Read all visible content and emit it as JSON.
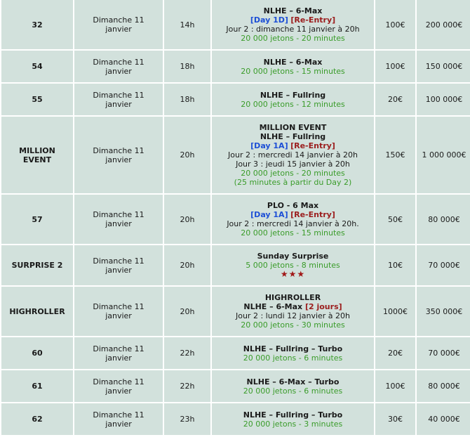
{
  "rows": [
    {
      "num": "32",
      "date": "Dimanche 11\njanvier",
      "time": "14h",
      "lines": [
        {
          "t": "NLHE – 6-Max",
          "c": "name"
        },
        {
          "parts": [
            {
              "t": "[Day 1D]",
              "c": "day"
            },
            {
              "t": " "
            },
            {
              "t": "[Re-Entry]",
              "c": "reentry"
            }
          ]
        },
        {
          "t": "Jour 2 : dimanche 11 janvier à 20h"
        },
        {
          "t": "20 000 jetons - 20 minutes",
          "c": "green"
        }
      ],
      "buyin": "100€",
      "prize": "200 000€",
      "h": 70
    },
    {
      "num": "54",
      "date": "Dimanche 11\njanvier",
      "time": "18h",
      "lines": [
        {
          "t": "NLHE – 6-Max",
          "c": "name"
        },
        {
          "t": "20 000 jetons - 15 minutes",
          "c": "green"
        }
      ],
      "buyin": "100€",
      "prize": "150 000€",
      "h": 45
    },
    {
      "num": "55",
      "date": "Dimanche 11\njanvier",
      "time": "18h",
      "lines": [
        {
          "t": "NLHE – Fullring",
          "c": "name"
        },
        {
          "t": "20 000 jetons - 12 minutes",
          "c": "green"
        }
      ],
      "buyin": "20€",
      "prize": "100 000€",
      "h": 45
    },
    {
      "num": "MILLION\nEVENT",
      "date": "Dimanche 11\njanvier",
      "time": "20h",
      "lines": [
        {
          "t": "MILLION EVENT",
          "c": "name"
        },
        {
          "t": "NLHE – Fullring",
          "c": "name"
        },
        {
          "parts": [
            {
              "t": "[Day 1A]",
              "c": "day"
            },
            {
              "t": " "
            },
            {
              "t": "[Re-Entry]",
              "c": "reentry"
            }
          ]
        },
        {
          "t": "Jour 2 : mercredi 14 janvier à 20h"
        },
        {
          "t": "Jour 3 : jeudi 15 janvier à 20h"
        },
        {
          "t": "20 000 jetons - 20 minutes",
          "c": "green"
        },
        {
          "t": "(25 minutes à partir du Day 2)",
          "c": "green"
        }
      ],
      "buyin": "150€",
      "prize": "1 000 000€",
      "h": 109
    },
    {
      "num": "57",
      "date": "Dimanche 11\njanvier",
      "time": "20h",
      "lines": [
        {
          "t": "PLO - 6 Max",
          "c": "name"
        },
        {
          "parts": [
            {
              "t": "[Day 1A]",
              "c": "day"
            },
            {
              "t": " "
            },
            {
              "t": "[Re-Entry]",
              "c": "reentry"
            }
          ]
        },
        {
          "t": "Jour 2 : mercredi 14 janvier à 20h."
        },
        {
          "t": "20 000 jetons - 15 minutes",
          "c": "green"
        }
      ],
      "buyin": "50€",
      "prize": "80 000€",
      "h": 70
    },
    {
      "num": "SURPRISE 2",
      "date": "Dimanche 11\njanvier",
      "time": "20h",
      "lines": [
        {
          "t": "Sunday Surprise",
          "c": "name"
        },
        {
          "t": "5 000 jetons - 8 minutes",
          "c": "green"
        },
        {
          "t": "★★★",
          "c": "stars"
        }
      ],
      "buyin": "10€",
      "prize": "70 000€",
      "h": 57
    },
    {
      "num": "HIGHROLLER",
      "date": "Dimanche 11\njanvier",
      "time": "20h",
      "lines": [
        {
          "t": "HIGHROLLER",
          "c": "name"
        },
        {
          "parts": [
            {
              "t": "NLHE – 6-Max ",
              "c": "name"
            },
            {
              "t": "[2 jours]",
              "c": "reentry"
            }
          ]
        },
        {
          "t": "Jour 2 : lundi 12 janvier à 20h"
        },
        {
          "t": "20 000 jetons - 30 minutes",
          "c": "green"
        }
      ],
      "buyin": "1000€",
      "prize": "350 000€",
      "h": 70
    },
    {
      "num": "60",
      "date": "Dimanche 11\njanvier",
      "time": "22h",
      "lines": [
        {
          "t": "NLHE – Fullring – Turbo",
          "c": "name"
        },
        {
          "t": "20 000 jetons - 6 minutes",
          "c": "green"
        }
      ],
      "buyin": "20€",
      "prize": "70 000€",
      "h": 45
    },
    {
      "num": "61",
      "date": "Dimanche 11\njanvier",
      "time": "22h",
      "lines": [
        {
          "t": "NLHE – 6-Max – Turbo",
          "c": "name"
        },
        {
          "t": "20 000 jetons - 6 minutes",
          "c": "green"
        }
      ],
      "buyin": "100€",
      "prize": "80 000€",
      "h": 45
    },
    {
      "num": "62",
      "date": "Dimanche 11\njanvier",
      "time": "23h",
      "lines": [
        {
          "t": "NLHE – Fullring – Turbo",
          "c": "name"
        },
        {
          "t": "20 000 jetons - 3 minutes",
          "c": "green"
        }
      ],
      "buyin": "30€",
      "prize": "40 000€",
      "h": 45
    }
  ]
}
